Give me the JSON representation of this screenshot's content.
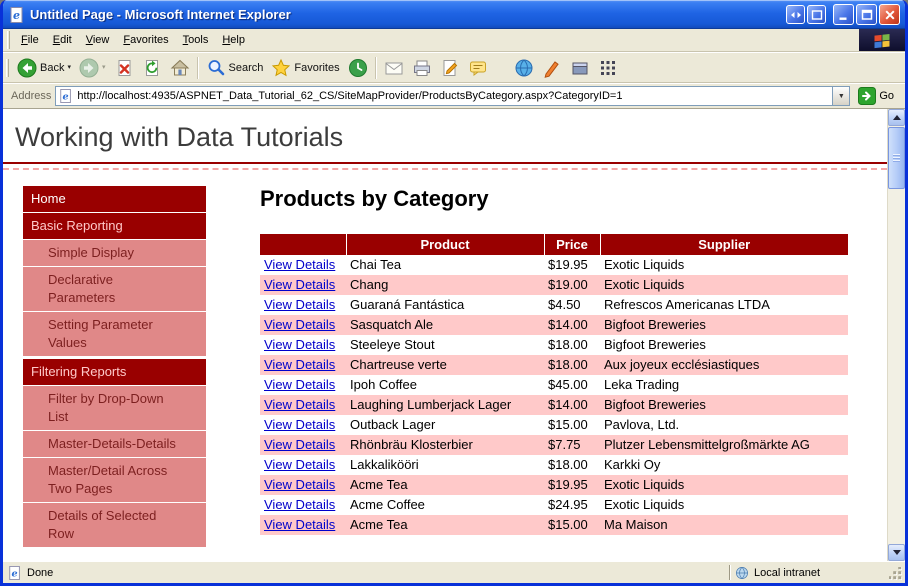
{
  "window": {
    "title": "Untitled Page - Microsoft Internet Explorer",
    "status_text": "Done",
    "zone_text": "Local intranet"
  },
  "menu": {
    "items": [
      "File",
      "Edit",
      "View",
      "Favorites",
      "Tools",
      "Help"
    ]
  },
  "toolbar": {
    "back_label": "Back",
    "search_label": "Search",
    "favorites_label": "Favorites"
  },
  "address": {
    "label": "Address",
    "url": "http://localhost:4935/ASPNET_Data_Tutorial_62_CS/SiteMapProvider/ProductsByCategory.aspx?CategoryID=1",
    "go_label": "Go"
  },
  "page": {
    "site_title": "Working with Data Tutorials",
    "heading": "Products by Category",
    "sidebar": {
      "items": [
        {
          "label": "Home",
          "level": 1
        },
        {
          "label": "Basic Reporting",
          "level": 1
        },
        {
          "label": "Simple Display",
          "level": 2
        },
        {
          "label": "Declarative Parameters",
          "level": 2
        },
        {
          "label": "Setting Parameter Values",
          "level": 2
        },
        {
          "label": "Filtering Reports",
          "level": 1
        },
        {
          "label": "Filter by Drop-Down List",
          "level": 2
        },
        {
          "label": "Master-Details-Details",
          "level": 2
        },
        {
          "label": "Master/Detail Across Two Pages",
          "level": 2
        },
        {
          "label": "Details of Selected Row",
          "level": 2
        }
      ]
    },
    "table": {
      "headers": [
        "",
        "Product",
        "Price",
        "Supplier"
      ],
      "link_label": "View Details",
      "rows": [
        {
          "product": "Chai Tea",
          "price": "$19.95",
          "supplier": "Exotic Liquids"
        },
        {
          "product": "Chang",
          "price": "$19.00",
          "supplier": "Exotic Liquids"
        },
        {
          "product": "Guaraná Fantástica",
          "price": "$4.50",
          "supplier": "Refrescos Americanas LTDA"
        },
        {
          "product": "Sasquatch Ale",
          "price": "$14.00",
          "supplier": "Bigfoot Breweries"
        },
        {
          "product": "Steeleye Stout",
          "price": "$18.00",
          "supplier": "Bigfoot Breweries"
        },
        {
          "product": "Chartreuse verte",
          "price": "$18.00",
          "supplier": "Aux joyeux ecclésiastiques"
        },
        {
          "product": "Ipoh Coffee",
          "price": "$45.00",
          "supplier": "Leka Trading"
        },
        {
          "product": "Laughing Lumberjack Lager",
          "price": "$14.00",
          "supplier": "Bigfoot Breweries"
        },
        {
          "product": "Outback Lager",
          "price": "$15.00",
          "supplier": "Pavlova, Ltd."
        },
        {
          "product": "Rhönbräu Klosterbier",
          "price": "$7.75",
          "supplier": "Plutzer Lebensmittelgroßmärkte AG"
        },
        {
          "product": "Lakkalikööri",
          "price": "$18.00",
          "supplier": "Karkki Oy"
        },
        {
          "product": "Acme Tea",
          "price": "$19.95",
          "supplier": "Exotic Liquids"
        },
        {
          "product": "Acme Coffee",
          "price": "$24.95",
          "supplier": "Exotic Liquids"
        },
        {
          "product": "Acme Tea",
          "price": "$15.00",
          "supplier": "Ma Maison"
        }
      ]
    }
  },
  "colors": {
    "maroon": "#990000",
    "subitem_bg": "#e08888",
    "alt_row": "#ffc9c9",
    "link": "#0000cc"
  }
}
